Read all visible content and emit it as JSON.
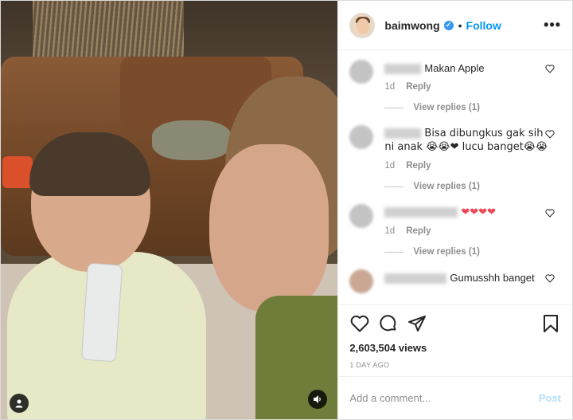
{
  "post": {
    "username": "baimwong",
    "follow_label": "Follow",
    "more_label": "•••",
    "dot": "•",
    "views": "2,603,504 views",
    "date": "1 DAY AGO",
    "add_comment_placeholder": "Add a comment...",
    "post_label": "Post"
  },
  "comments": [
    {
      "text": "Makan Apple",
      "time": "1d",
      "reply_label": "Reply",
      "view_replies": "View replies (1)"
    },
    {
      "text": "Bisa dibungkus gak sih ni anak 😭😭❤ lucu banget😭😭",
      "time": "1d",
      "reply_label": "Reply",
      "view_replies": "View replies (1)"
    },
    {
      "text": "❤❤❤❤",
      "time": "1d",
      "reply_label": "Reply",
      "view_replies": "View replies (1)"
    },
    {
      "text": "Gumusshh banget",
      "time": "",
      "reply_label": "",
      "view_replies": ""
    }
  ],
  "colors": {
    "accent": "#0095f6",
    "post_disabled": "#b2dffc",
    "heart": "#ed4956"
  }
}
